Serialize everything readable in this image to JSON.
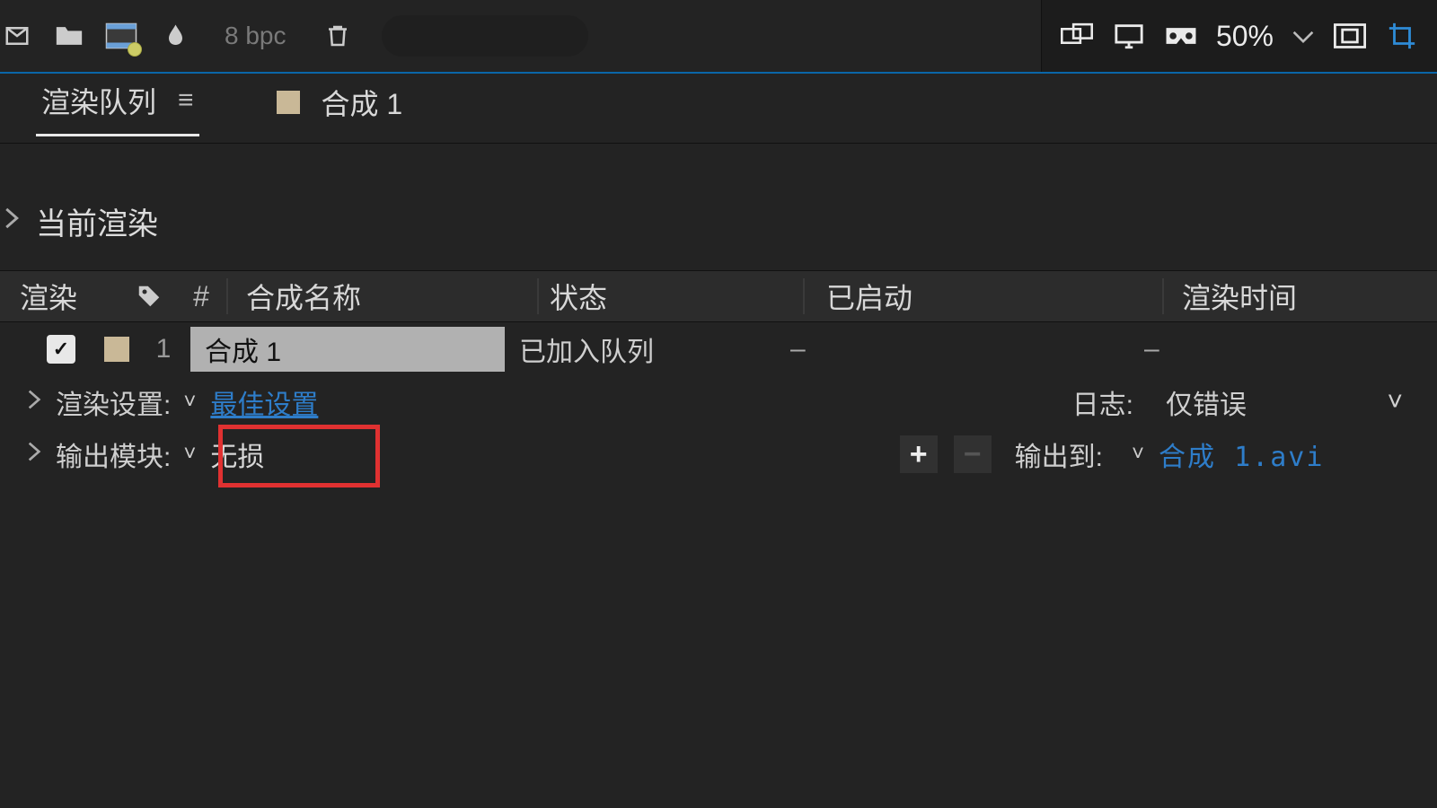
{
  "toolbar": {
    "bpc": "8 bpc",
    "zoom": "50%"
  },
  "tabs": {
    "render_queue": "渲染队列",
    "comp1": "合成 1"
  },
  "section": {
    "current_render": "当前渲染"
  },
  "columns": {
    "render": "渲染",
    "num": "#",
    "comp_name": "合成名称",
    "status": "状态",
    "started": "已启动",
    "render_time": "渲染时间"
  },
  "row": {
    "num": "1",
    "name": "合成 1",
    "status": "已加入队列",
    "started": "–",
    "render_time": "–"
  },
  "render_settings": {
    "label": "渲染设置:",
    "value": "最佳设置"
  },
  "output_module": {
    "label": "输出模块:",
    "value": "无损"
  },
  "log": {
    "label": "日志:",
    "value": "仅错误"
  },
  "output_to": {
    "label": "输出到:",
    "value": "合成 1.avi"
  },
  "icons": {
    "plus": "+",
    "minus": "−",
    "check": "✓",
    "chev": "˅"
  }
}
